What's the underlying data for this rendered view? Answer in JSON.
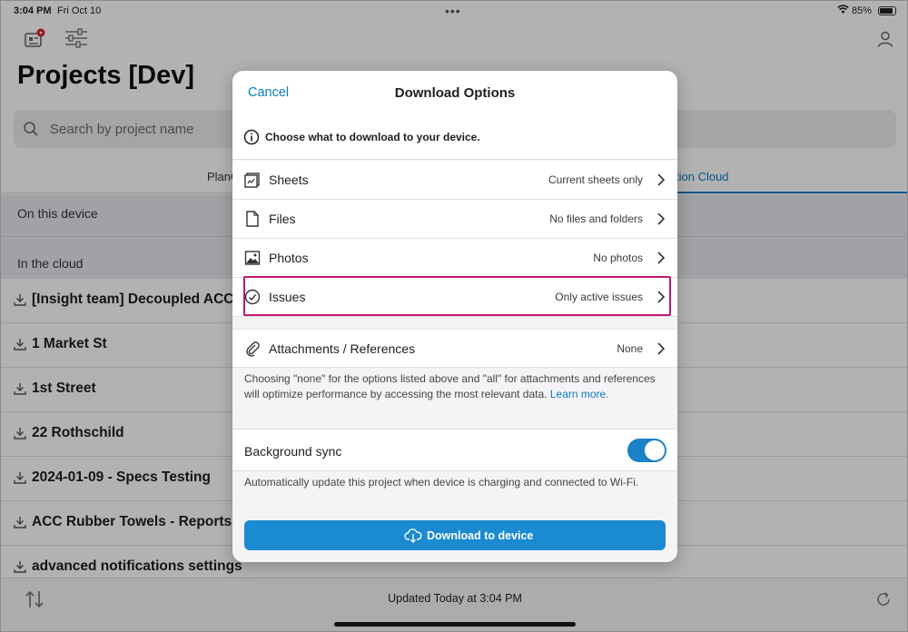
{
  "status_bar": {
    "time": "3:04 PM",
    "date": "Fri Oct 10",
    "battery": "85%"
  },
  "header": {
    "title": "Projects [Dev]"
  },
  "search": {
    "placeholder": "Search by project name"
  },
  "tabs": {
    "left_partial": "PlanG",
    "right_partial": "tion Cloud"
  },
  "sections": {
    "on_device": "On this device",
    "in_cloud": "In the cloud"
  },
  "projects": [
    {
      "name": "[Insight team] Decoupled ACC"
    },
    {
      "name": "1 Market St"
    },
    {
      "name": "1st Street"
    },
    {
      "name": "22 Rothschild"
    },
    {
      "name": "2024-01-09 - Specs Testing"
    },
    {
      "name": "ACC Rubber Towels - Reports Q"
    },
    {
      "name": "advanced notifications settings"
    }
  ],
  "bottom": {
    "updated": "Updated Today at 3:04 PM"
  },
  "modal": {
    "cancel": "Cancel",
    "title": "Download Options",
    "info": "Choose what to download to your device.",
    "options": [
      {
        "label": "Sheets",
        "value": "Current sheets only",
        "icon": "sheets-icon"
      },
      {
        "label": "Files",
        "value": "No files and folders",
        "icon": "file-icon"
      },
      {
        "label": "Photos",
        "value": "No photos",
        "icon": "photo-icon"
      },
      {
        "label": "Issues",
        "value": "Only active issues",
        "icon": "checkmark-circle-icon"
      }
    ],
    "attachments": {
      "label": "Attachments / References",
      "value": "None"
    },
    "note": "Choosing \"none\" for the options listed above and \"all\" for attachments and references will optimize performance by accessing the most relevant data.",
    "learn_more": "Learn more.",
    "background_sync": {
      "label": "Background sync",
      "enabled": true
    },
    "sync_note": "Automatically update this project when device is charging and connected to Wi-Fi.",
    "download_button": "Download to device"
  },
  "colors": {
    "accent": "#0a7cc4",
    "button": "#1a8ad1",
    "highlight": "#c0186f"
  }
}
